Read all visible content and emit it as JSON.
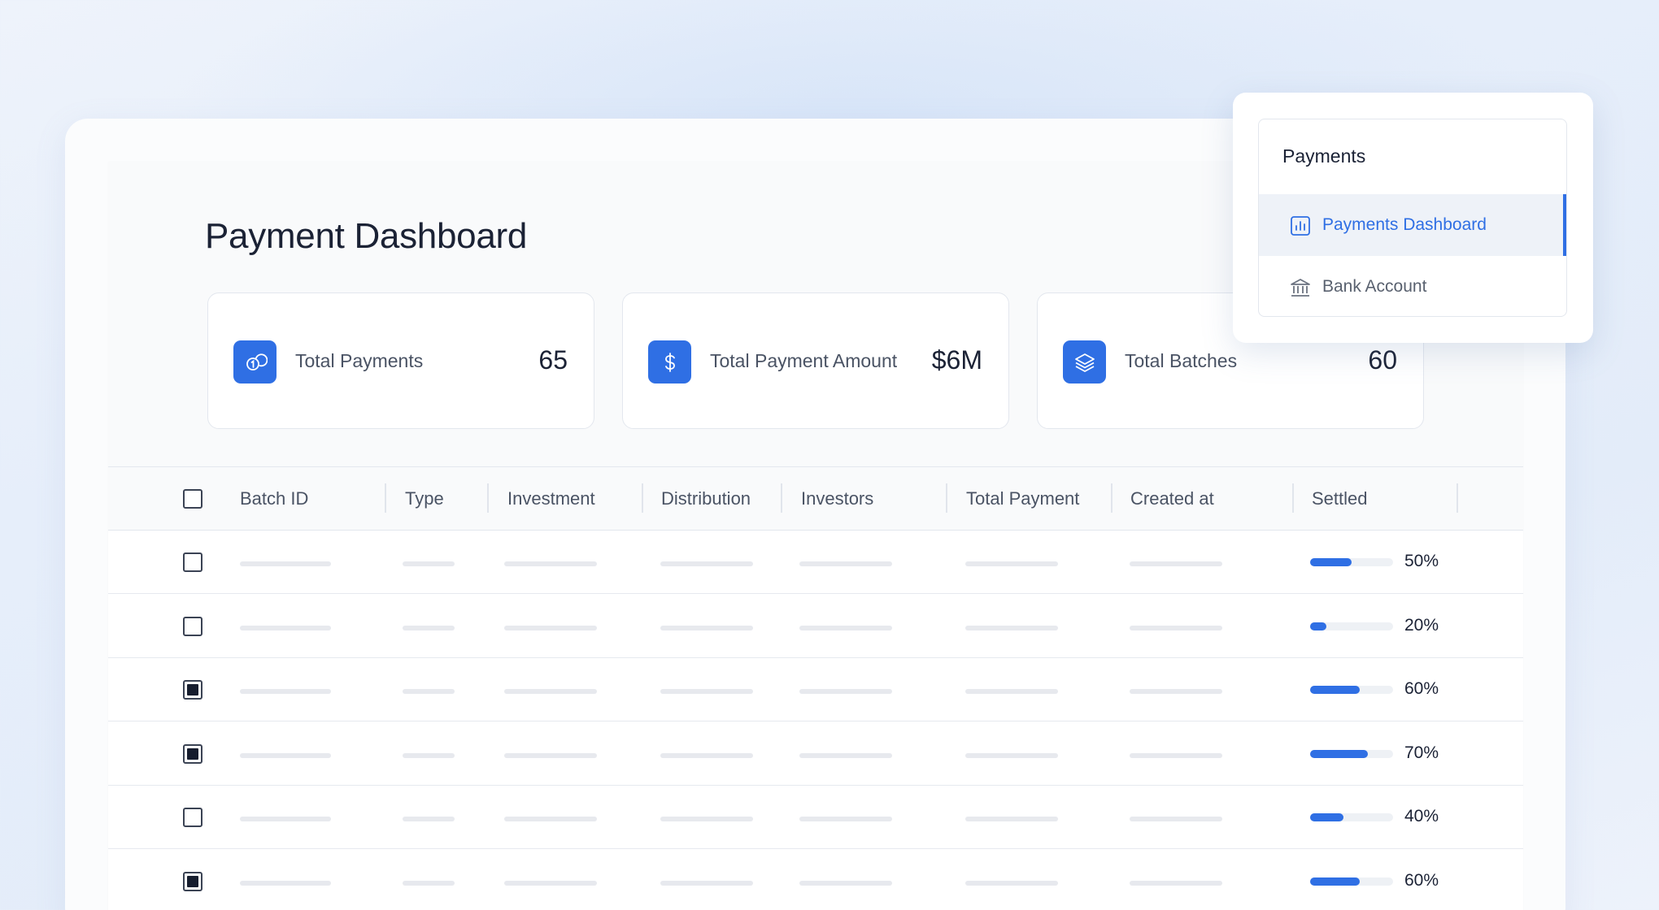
{
  "page": {
    "title": "Payment Dashboard"
  },
  "stats": [
    {
      "label": "Total Payments",
      "value": "65",
      "icon": "coins-icon"
    },
    {
      "label": "Total Payment Amount",
      "value": "$6M",
      "icon": "dollar-icon"
    },
    {
      "label": "Total Batches",
      "value": "60",
      "icon": "layers-icon"
    }
  ],
  "table": {
    "columns": [
      "Batch ID",
      "Type",
      "Investment",
      "Distribution",
      "Investors",
      "Total Payment",
      "Created at",
      "Settled"
    ],
    "rows": [
      {
        "checked": false,
        "settled": 0.5,
        "settled_label": "50%"
      },
      {
        "checked": false,
        "settled": 0.2,
        "settled_label": "20%"
      },
      {
        "checked": true,
        "settled": 0.6,
        "settled_label": "60%"
      },
      {
        "checked": true,
        "settled": 0.7,
        "settled_label": "70%"
      },
      {
        "checked": false,
        "settled": 0.4,
        "settled_label": "40%"
      },
      {
        "checked": true,
        "settled": 0.6,
        "settled_label": "60%"
      }
    ]
  },
  "nav": {
    "section_title": "Payments",
    "items": [
      {
        "label": "Payments Dashboard",
        "icon": "bar-chart-icon",
        "active": true
      },
      {
        "label": "Bank Account",
        "icon": "bank-icon",
        "active": false
      }
    ]
  },
  "colors": {
    "accent": "#2f6fe4",
    "text": "#1b2235",
    "muted": "#4a5364",
    "border": "#e3e7ee"
  }
}
